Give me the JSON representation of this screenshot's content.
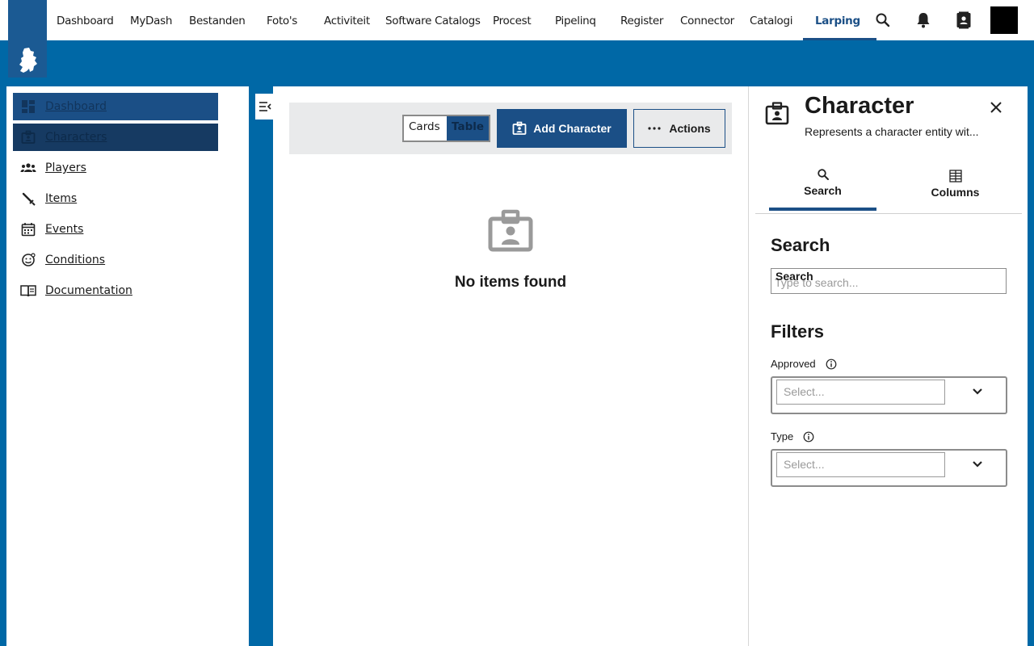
{
  "topnav": {
    "items": [
      {
        "label": "Dashboard",
        "active": false
      },
      {
        "label": "MyDash",
        "active": false
      },
      {
        "label": "Bestanden",
        "active": false
      },
      {
        "label": "Foto's",
        "active": false
      },
      {
        "label": "Activiteit",
        "active": false
      },
      {
        "label": "Software Catalogs",
        "active": false
      },
      {
        "label": "Procest",
        "active": false
      },
      {
        "label": "Pipelinq",
        "active": false
      },
      {
        "label": "Register",
        "active": false
      },
      {
        "label": "Connector",
        "active": false
      },
      {
        "label": "Catalogi",
        "active": false
      },
      {
        "label": "Larping",
        "active": true
      }
    ],
    "icons": [
      "search-icon",
      "bell-icon",
      "contacts-icon",
      "user-avatar"
    ]
  },
  "sidebar": {
    "items": [
      {
        "label": "Dashboard",
        "icon": "dashboard-icon"
      },
      {
        "label": "Characters",
        "icon": "badge-icon"
      },
      {
        "label": "Players",
        "icon": "players-icon"
      },
      {
        "label": "Items",
        "icon": "sword-icon"
      },
      {
        "label": "Events",
        "icon": "calendar-icon"
      },
      {
        "label": "Conditions",
        "icon": "emoticon-icon"
      },
      {
        "label": "Documentation",
        "icon": "book-icon"
      }
    ]
  },
  "main": {
    "view_toggle": {
      "cards": "Cards",
      "table": "Table",
      "selected": "Table"
    },
    "add_button": "Add Character",
    "actions_button": "Actions",
    "empty_text": "No items found"
  },
  "panel": {
    "title": "Character",
    "subtitle": "Represents a character entity wit...",
    "tabs": {
      "search": "Search",
      "columns": "Columns"
    },
    "search_heading": "Search",
    "search_label": "Search",
    "search_placeholder": "Type to search...",
    "filters_heading": "Filters",
    "filters": {
      "approved": {
        "label": "Approved",
        "placeholder": "Select..."
      },
      "type": {
        "label": "Type",
        "placeholder": "Select..."
      }
    }
  },
  "colors": {
    "brand": "#1b4f86",
    "background": "#0068a6"
  }
}
